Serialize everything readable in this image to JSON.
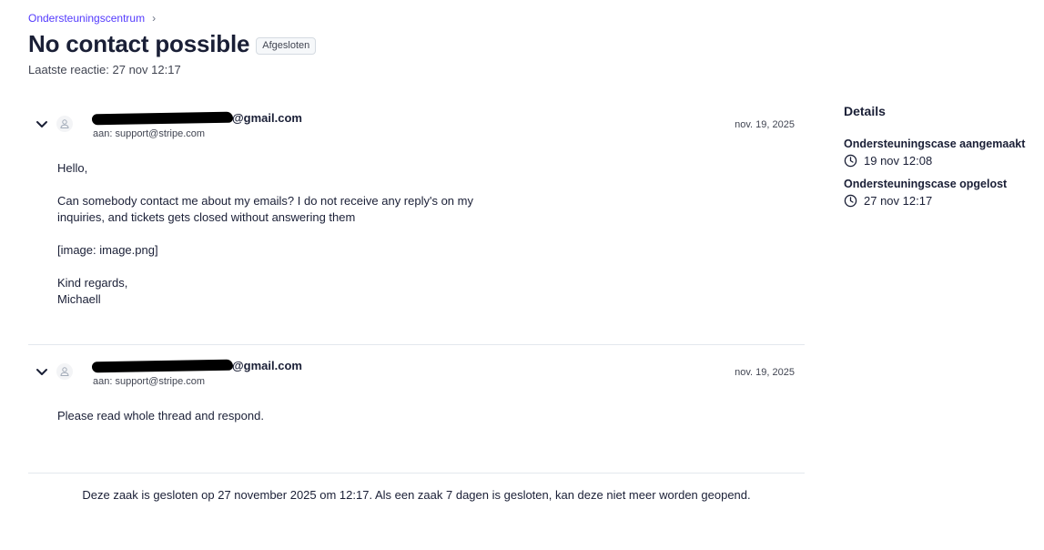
{
  "breadcrumb": {
    "link": "Ondersteuningscentrum",
    "separator": "›"
  },
  "header": {
    "title": "No contact possible",
    "status": "Afgesloten",
    "last_reply": "Laatste reactie: 27 nov 12:17"
  },
  "messages": [
    {
      "sender_suffix": "@gmail.com",
      "recipient": "aan: support@stripe.com",
      "date": "nov. 19, 2025",
      "paragraphs": [
        "Hello,",
        "Can somebody contact me about my emails? I do not receive any reply's on my\ninquiries, and tickets gets closed without answering them",
        "[image: image.png]",
        "Kind regards,\nMichaell"
      ]
    },
    {
      "sender_suffix": "@gmail.com",
      "recipient": "aan: support@stripe.com",
      "date": "nov. 19, 2025",
      "paragraphs": [
        "Please read whole thread and respond."
      ]
    }
  ],
  "closed_note": "Deze zaak is gesloten op 27 november 2025 om 12:17. Als een zaak 7 dagen is gesloten, kan deze niet meer worden geopend.",
  "details": {
    "title": "Details",
    "events": [
      {
        "title": "Ondersteuningscase aangemaakt",
        "time": "19 nov 12:08",
        "icon": "clock-icon"
      },
      {
        "title": "Ondersteuningscase opgelost",
        "time": "27 nov 12:17",
        "icon": "clock-icon"
      }
    ]
  },
  "colors": {
    "link": "#533afd",
    "text": "#1a1f36",
    "muted": "#414552",
    "divider": "#e3e8ee"
  }
}
